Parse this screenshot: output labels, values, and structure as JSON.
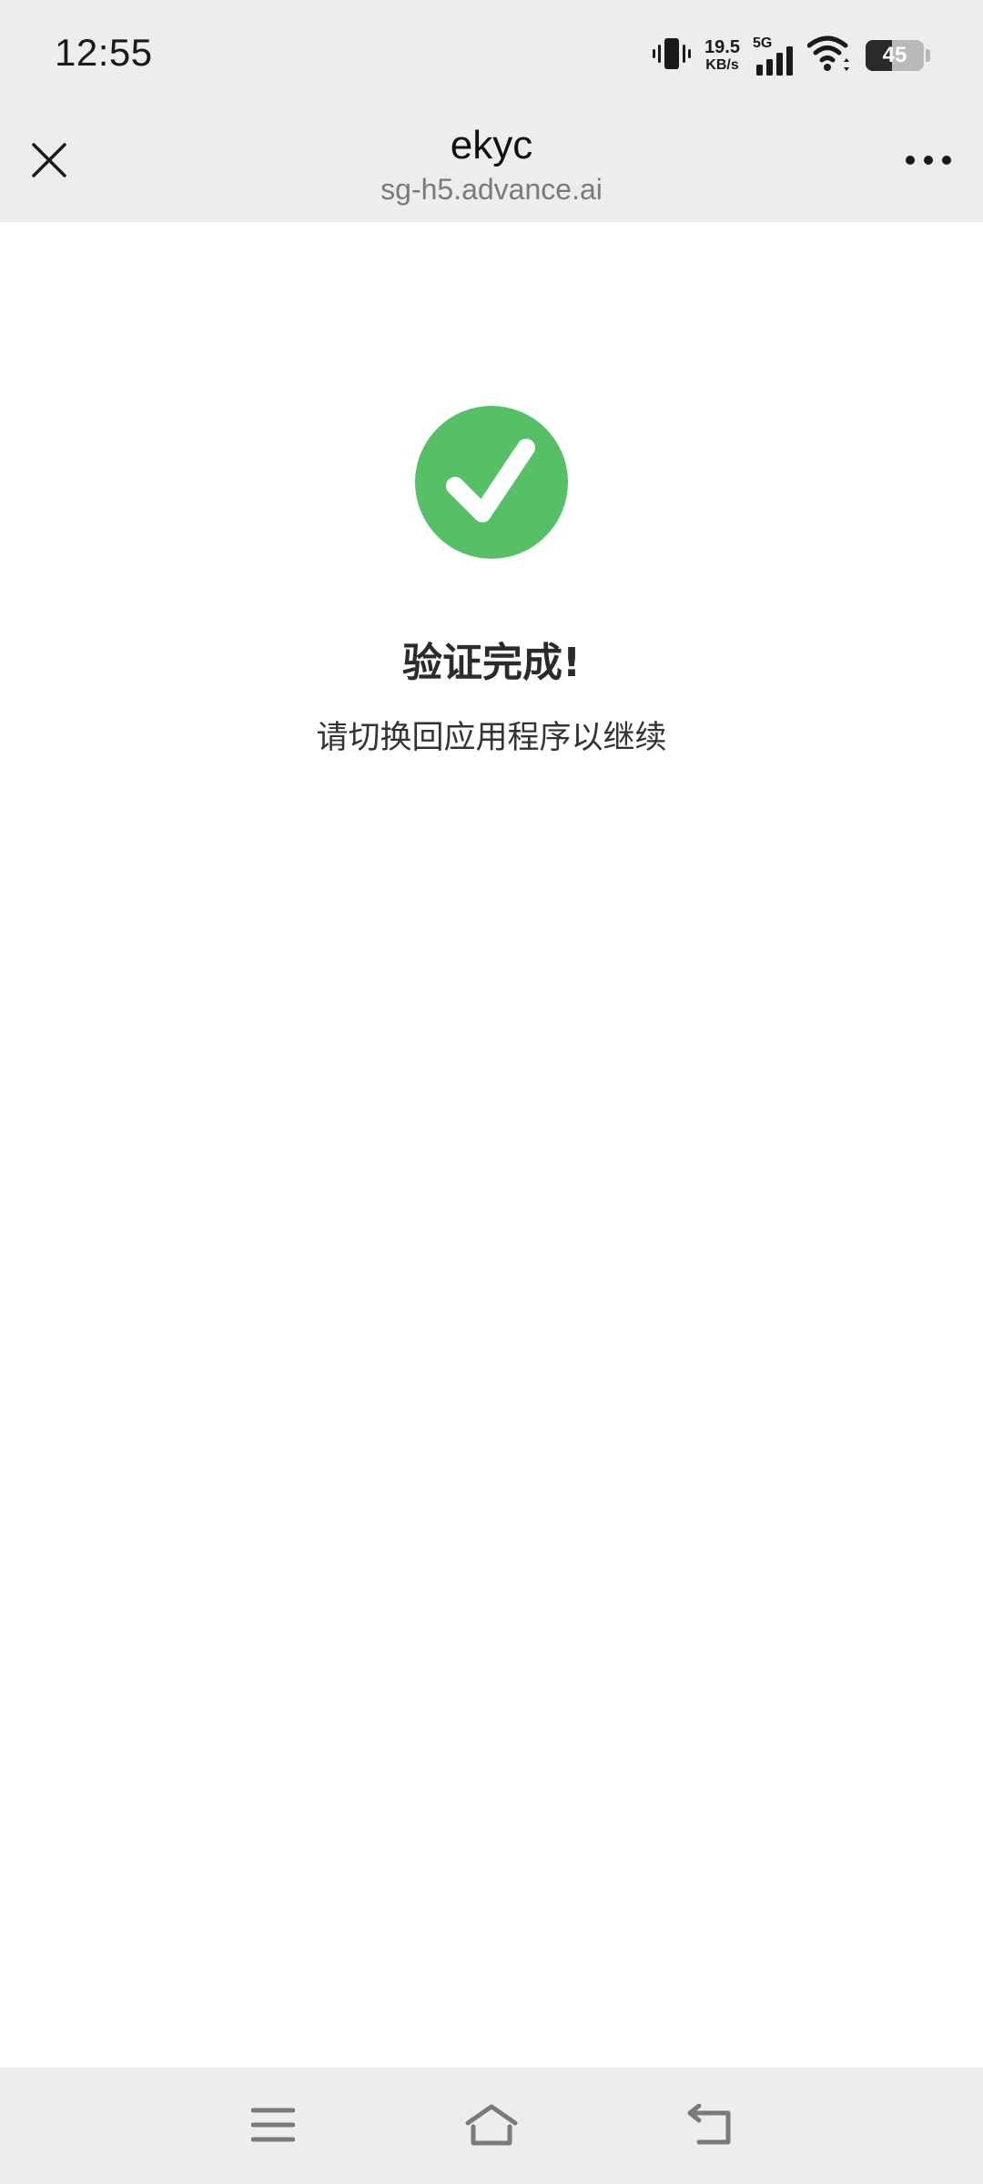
{
  "status_bar": {
    "time": "12:55",
    "net_speed_value": "19.5",
    "net_speed_unit": "KB/s",
    "network_type": "5G",
    "battery_level": "45",
    "battery_fraction": 0.45,
    "icons": [
      "vibrate-icon",
      "signal-icon",
      "wifi-icon",
      "battery-icon"
    ]
  },
  "header": {
    "title": "ekyc",
    "domain": "sg-h5.advance.ai",
    "icons": [
      "close-icon",
      "more-icon"
    ]
  },
  "result": {
    "title": "验证完成!",
    "subtitle": "请切换回应用程序以继续",
    "icon": "checkmark-icon",
    "accent_color": "#55c065"
  },
  "nav_bar": {
    "icons": [
      "menu-icon",
      "home-icon",
      "back-icon"
    ]
  }
}
